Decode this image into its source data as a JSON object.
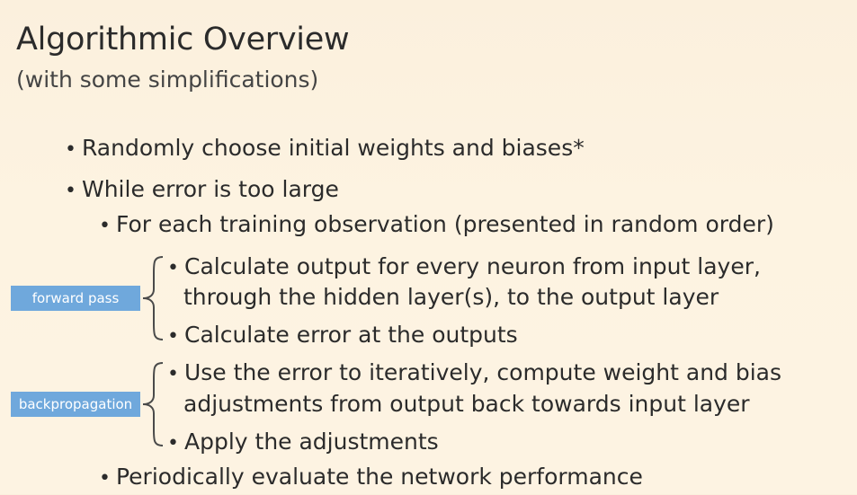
{
  "slide": {
    "title": "Algorithmic Overview",
    "subtitle": "(with some simplifications)",
    "bullets": {
      "b1": "Randomly choose initial weights and biases*",
      "b2": "While error is too large",
      "b3": "For each training observation (presented in random order)",
      "b4_line1": "Calculate output for every neuron from input layer,",
      "b4_line2": "through the hidden layer(s), to the output layer",
      "b5": "Calculate error at the outputs",
      "b6_line1": "Use the error to iteratively, compute weight and bias",
      "b6_line2": "adjustments from output back towards input layer",
      "b7": "Apply the adjustments",
      "b8": "Periodically evaluate the network performance"
    },
    "labels": {
      "forward": "forward pass",
      "backprop": "backpropagation"
    },
    "bullet_char": "•"
  },
  "colors": {
    "background": "#fdf3e1",
    "text": "#2b2b2b",
    "tag": "#6fa8dc"
  }
}
